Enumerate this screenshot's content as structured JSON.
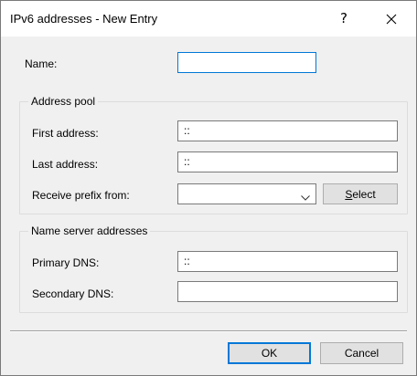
{
  "window": {
    "title": "IPv6 addresses - New Entry",
    "help_label": "?",
    "close_icon": "close-icon"
  },
  "name_field": {
    "label": "Name:",
    "value": ""
  },
  "address_pool": {
    "title": "Address pool",
    "first_address_label": "First address:",
    "first_address_value": "::",
    "last_address_label": "Last address:",
    "last_address_value": "::",
    "receive_prefix_label": "Receive prefix from:",
    "receive_prefix_value": "",
    "select_button_label": "Select"
  },
  "name_servers": {
    "title": "Name server addresses",
    "primary_dns_label": "Primary DNS:",
    "primary_dns_value": "::",
    "secondary_dns_label": "Secondary DNS:",
    "secondary_dns_value": ""
  },
  "footer": {
    "ok_label": "OK",
    "cancel_label": "Cancel"
  },
  "colors": {
    "accent": "#0078d7",
    "dialog_bg": "#f0f0f0",
    "titlebar_bg": "#ffffff",
    "button_bg": "#e1e1e1"
  }
}
